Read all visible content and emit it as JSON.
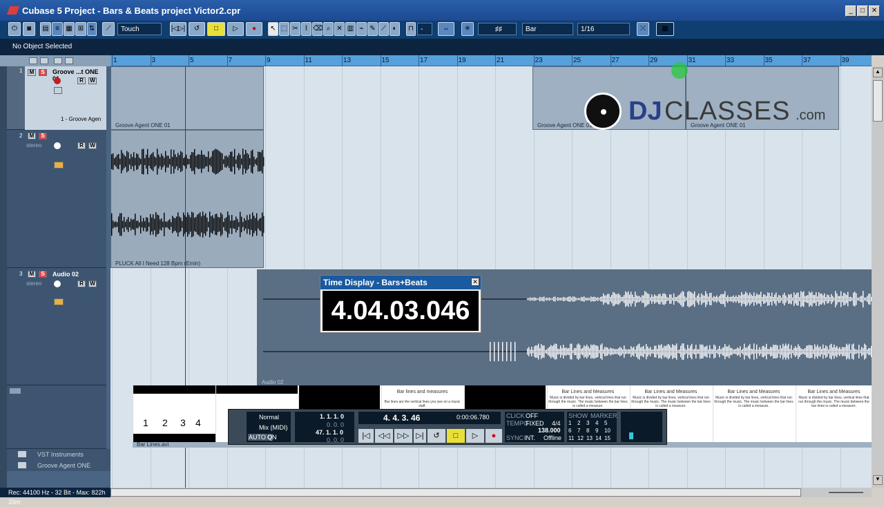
{
  "window": {
    "title": "Cubase 5 Project - Bars & Beats project Victor2.cpr",
    "minimize": "_",
    "maximize": "□",
    "close": "✕"
  },
  "toolbar": {
    "automation_mode": "Touch",
    "grid_type": "Bar",
    "quantize": "1/16"
  },
  "infobar": {
    "text": "No Object Selected"
  },
  "ruler": {
    "labels": [
      "1",
      "3",
      "5",
      "7",
      "9",
      "11",
      "13",
      "15",
      "17",
      "19",
      "21",
      "23",
      "25",
      "27",
      "29",
      "31",
      "33",
      "35",
      "37",
      "39"
    ]
  },
  "tracks": [
    {
      "number": "1",
      "name": "Groove ...t ONE 01",
      "sub": "1 - Groove Agen",
      "type": "instrument"
    },
    {
      "number": "2",
      "name": "",
      "sub": "stereo",
      "type": "audio"
    },
    {
      "number": "3",
      "name": "Audio 02",
      "sub": "stereo",
      "type": "audio"
    }
  ],
  "folders": {
    "vst": "VST Instruments",
    "groove": "Groove Agent ONE"
  },
  "parts": {
    "groove1": "Groove Agent ONE 01",
    "groove2": "Groove Agent ONE 01",
    "groove3": "Groove Agent ONE 01",
    "pluck": "PLUCK All I Need 128 Bpm (Emin)",
    "audio02": "Audio 02",
    "video": "Bar Lines.avi"
  },
  "time_display": {
    "title": "Time Display - Bars+Beats",
    "value": "4.04.03.046"
  },
  "transport": {
    "mode": "Normal",
    "record_mode": "Mix (MIDI)",
    "auto_q": "AUTO Q",
    "auto_q_state": "ON",
    "left_locator": "1. 1. 1. 0",
    "left_sub": "0. 0. 0",
    "right_locator": "47. 1. 1. 0",
    "right_sub": "0. 0. 0",
    "position_bars": "4. 4. 3. 46",
    "position_time": "0:00:06.780",
    "click": "CLICK",
    "click_state": "OFF",
    "tempo": "TEMPO",
    "tempo_mode": "FIXED",
    "signature": "4/4",
    "tempo_value": "138.000",
    "sync": "SYNC",
    "sync_source": "INT.",
    "sync_state": "Offline",
    "show": "SHOW",
    "marker": "MARKER",
    "markers": [
      "1",
      "2",
      "3",
      "4",
      "5",
      "6",
      "7",
      "8",
      "9",
      "10",
      "11",
      "12",
      "13",
      "14",
      "15"
    ]
  },
  "video": {
    "slide1_title": "Bar lines and measures",
    "slide1_text": "Bar lines are the vertical lines you see on a music staff.",
    "slide_title": "Bar Lines and Measures",
    "slide_text": "Music is divided by bar lines, vertical lines that run through the music. The music between the bar lines is called a measure.",
    "notes": [
      "1",
      "2",
      "3",
      "4"
    ]
  },
  "watermark": {
    "text_dj": "DJ",
    "text_classes": "CLASSES",
    "text_com": ".com"
  },
  "status": {
    "text": "Rec: 44100 Hz - 32 Bit - Max: 822h 33m"
  }
}
